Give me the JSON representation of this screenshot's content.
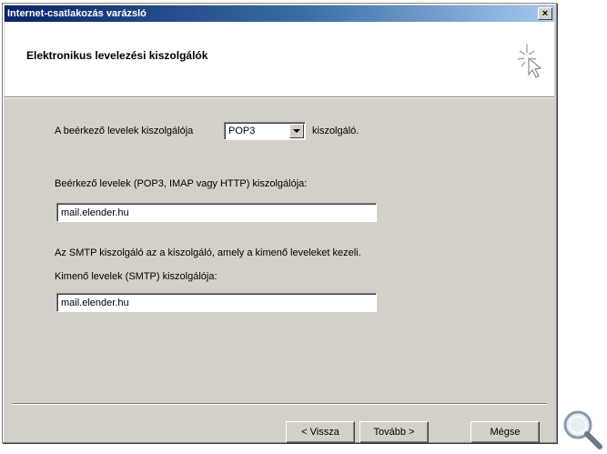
{
  "window": {
    "title": "Internet-csatlakozás varázsló",
    "close_label": "×"
  },
  "header": {
    "title": "Elektronikus levelezési kiszolgálók",
    "icon": "wizard-sparkle-cursor-icon"
  },
  "incoming_type": {
    "label": "A beérkező levelek kiszolgálója",
    "selected": "POP3",
    "suffix": "kiszolgáló."
  },
  "incoming_server": {
    "label": "Beérkező levelek (POP3, IMAP vagy HTTP) kiszolgálója:",
    "value": "mail.elender.hu"
  },
  "smtp_note": "Az SMTP kiszolgáló az a kiszolgáló, amely a kimenő leveleket kezeli.",
  "outgoing_server": {
    "label": "Kimenő levelek (SMTP) kiszolgálója:",
    "value": "mail.elender.hu"
  },
  "buttons": {
    "back": "< Vissza",
    "next": "Tovább >",
    "cancel": "Mégse"
  },
  "decor": {
    "magnifier": "magnifier-icon"
  }
}
